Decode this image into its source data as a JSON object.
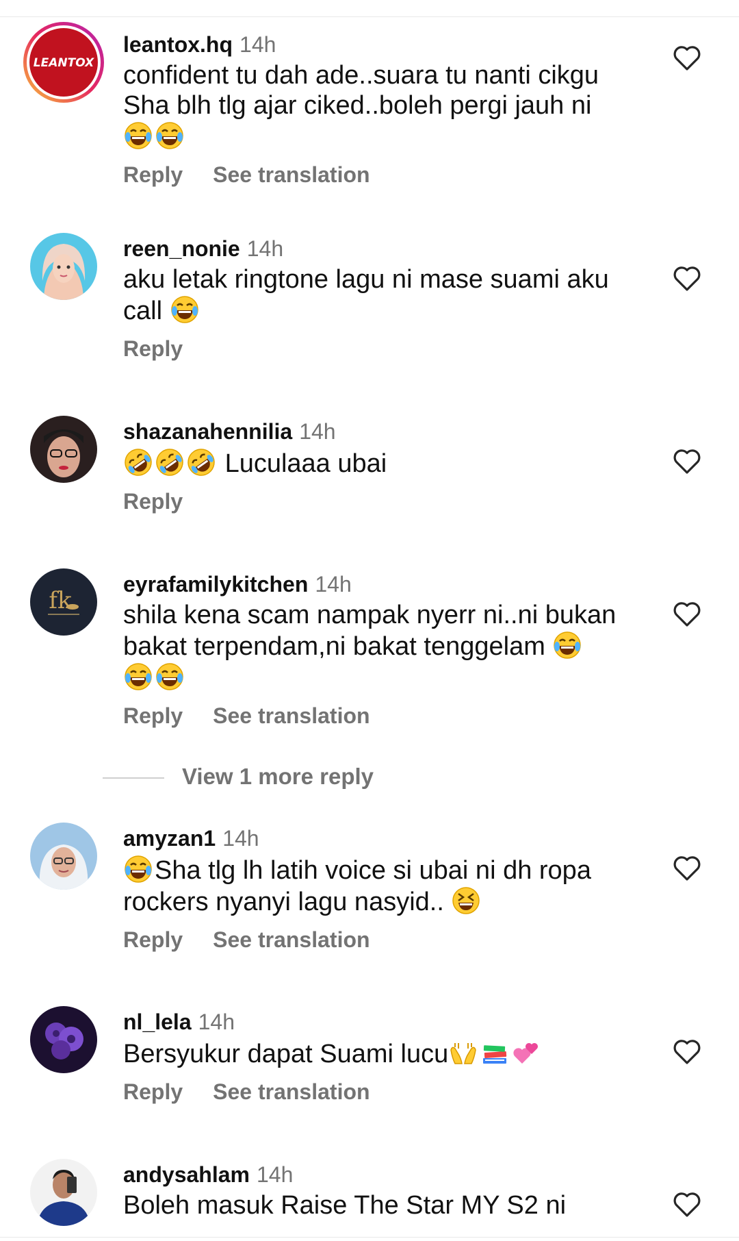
{
  "comments": [
    {
      "username": "leantox.hq",
      "time": "14h",
      "text": "confident tu dah ade..suara tu nanti cikgu Sha blh tlg ajar ciked..boleh pergi jauh ni",
      "reply_label": "Reply",
      "translate_label": "See translation",
      "avatar_text": "LEANTOX"
    },
    {
      "username": "reen_nonie",
      "time": "14h",
      "text": "aku letak ringtone lagu ni mase suami aku call",
      "reply_label": "Reply"
    },
    {
      "username": "shazanahennilia",
      "time": "14h",
      "text": "Luculaaa ubai",
      "reply_label": "Reply"
    },
    {
      "username": "eyrafamilykitchen",
      "time": "14h",
      "text": "shila kena scam nampak nyerr ni..ni bukan bakat terpendam,ni bakat tenggelam",
      "reply_label": "Reply",
      "translate_label": "See translation",
      "avatar_text": "fk",
      "view_more": "View 1 more reply"
    },
    {
      "username": "amyzan1",
      "time": "14h",
      "text": "Sha tlg lh latih voice si ubai ni dh ropa rockers nyanyi lagu nasyid..",
      "reply_label": "Reply",
      "translate_label": "See translation"
    },
    {
      "username": "nl_lela",
      "time": "14h",
      "text": "Bersyukur dapat Suami lucu",
      "reply_label": "Reply",
      "translate_label": "See translation"
    },
    {
      "username": "andysahlam",
      "time": "14h",
      "text": "Boleh masuk Raise The Star MY S2 ni"
    }
  ],
  "icons": {
    "like": "heart-outline-icon",
    "emoji_laugh": "face-with-tears-of-joy",
    "emoji_rofl": "rolling-on-floor-laughing",
    "emoji_squint": "grinning-squinting-face",
    "emoji_hands": "palms-up-together",
    "emoji_books": "books",
    "emoji_hearts": "two-hearts"
  },
  "colors": {
    "text": "#111111",
    "secondary": "#737373",
    "background": "#ffffff"
  }
}
